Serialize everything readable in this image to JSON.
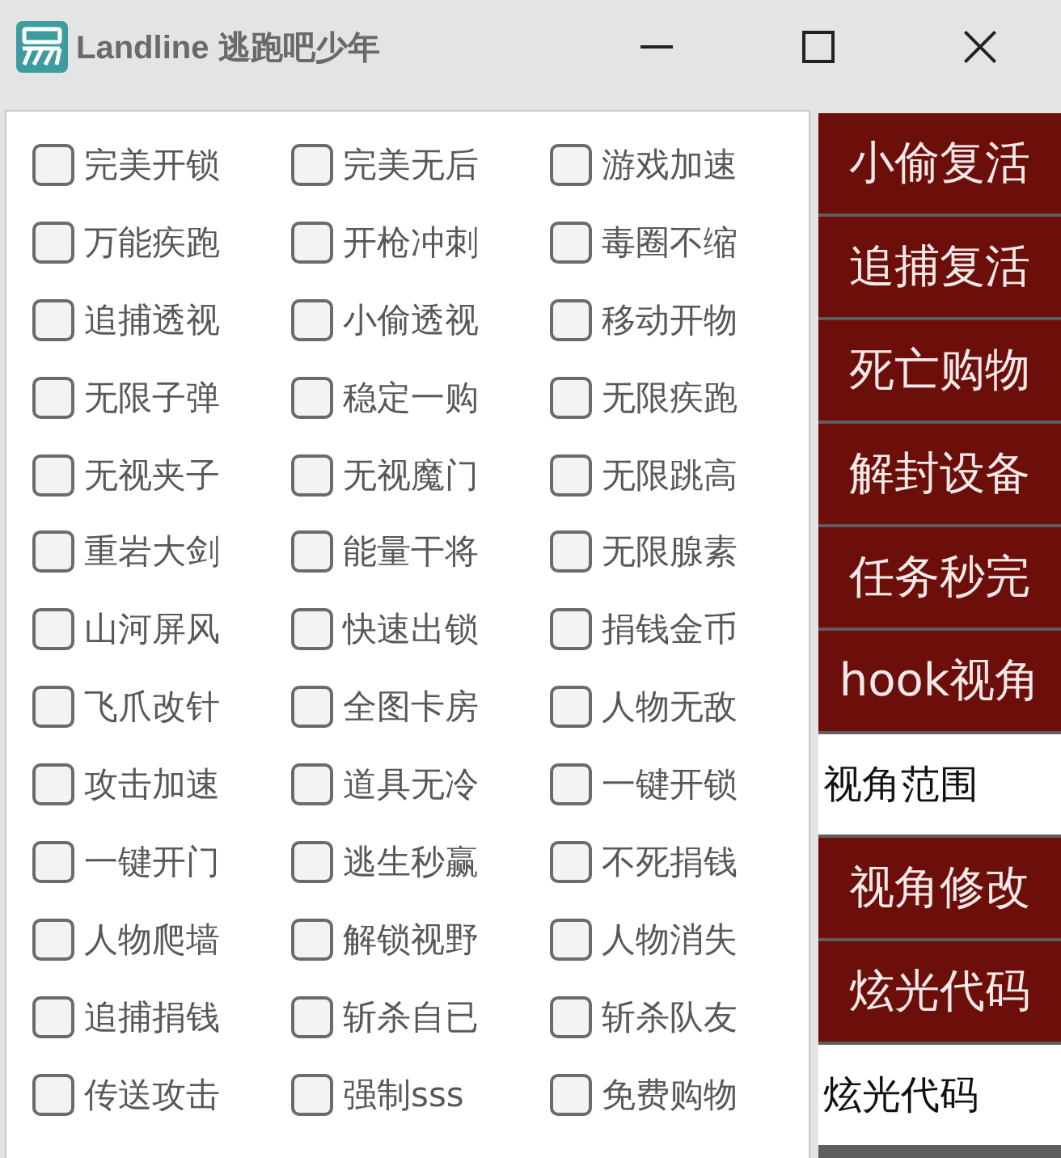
{
  "window": {
    "title": "Landline 逃跑吧少年"
  },
  "options": [
    {
      "label": "完美开锁",
      "checked": false
    },
    {
      "label": "完美无后",
      "checked": false
    },
    {
      "label": "游戏加速",
      "checked": false
    },
    {
      "label": "万能疾跑",
      "checked": false
    },
    {
      "label": "开枪冲刺",
      "checked": false
    },
    {
      "label": "毒圈不缩",
      "checked": false
    },
    {
      "label": "追捕透视",
      "checked": false
    },
    {
      "label": "小偷透视",
      "checked": false
    },
    {
      "label": "移动开物",
      "checked": false
    },
    {
      "label": "无限子弹",
      "checked": false
    },
    {
      "label": "稳定一购",
      "checked": false
    },
    {
      "label": "无限疾跑",
      "checked": false
    },
    {
      "label": "无视夹子",
      "checked": false
    },
    {
      "label": "无视魔门",
      "checked": false
    },
    {
      "label": "无限跳高",
      "checked": false
    },
    {
      "label": "重岩大剑",
      "checked": false
    },
    {
      "label": "能量干将",
      "checked": false
    },
    {
      "label": "无限腺素",
      "checked": false
    },
    {
      "label": "山河屏风",
      "checked": false
    },
    {
      "label": "快速出锁",
      "checked": false
    },
    {
      "label": "捐钱金币",
      "checked": false
    },
    {
      "label": "飞爪改针",
      "checked": false
    },
    {
      "label": "全图卡房",
      "checked": false
    },
    {
      "label": "人物无敌",
      "checked": false
    },
    {
      "label": "攻击加速",
      "checked": false
    },
    {
      "label": "道具无冷",
      "checked": false
    },
    {
      "label": "一键开锁",
      "checked": false
    },
    {
      "label": "一键开门",
      "checked": false
    },
    {
      "label": "逃生秒赢",
      "checked": false
    },
    {
      "label": "不死捐钱",
      "checked": false
    },
    {
      "label": "人物爬墙",
      "checked": false
    },
    {
      "label": "解锁视野",
      "checked": false
    },
    {
      "label": "人物消失",
      "checked": false
    },
    {
      "label": "追捕捐钱",
      "checked": false
    },
    {
      "label": "斩杀自已",
      "checked": false
    },
    {
      "label": "斩杀队友",
      "checked": false
    },
    {
      "label": "传送攻击",
      "checked": false
    },
    {
      "label": "强制sss",
      "checked": false
    },
    {
      "label": "免费购物",
      "checked": false
    }
  ],
  "side_panel": [
    {
      "kind": "button",
      "label": "小偷复活"
    },
    {
      "kind": "button",
      "label": "追捕复活"
    },
    {
      "kind": "button",
      "label": "死亡购物"
    },
    {
      "kind": "button",
      "label": "解封设备"
    },
    {
      "kind": "button",
      "label": "任务秒完"
    },
    {
      "kind": "button",
      "label": "hook视角"
    },
    {
      "kind": "field",
      "value": "视角范围"
    },
    {
      "kind": "button",
      "label": "视角修改"
    },
    {
      "kind": "button",
      "label": "炫光代码"
    },
    {
      "kind": "field",
      "value": "炫光代码"
    }
  ]
}
